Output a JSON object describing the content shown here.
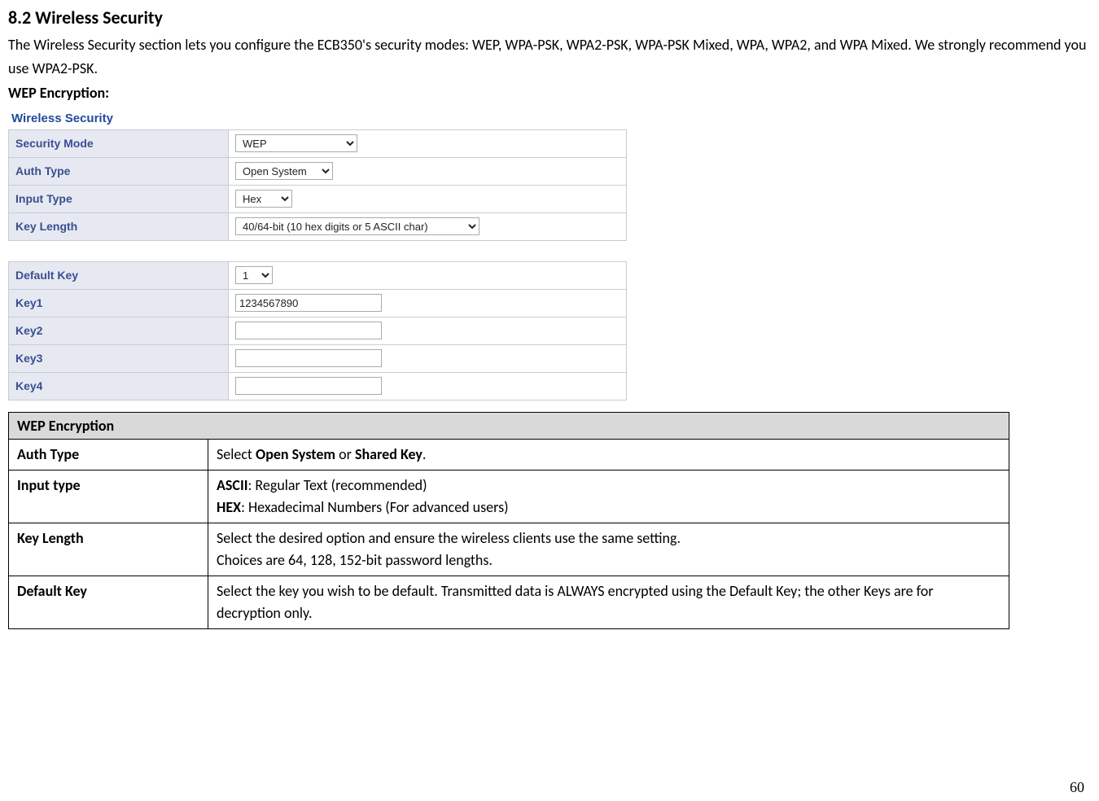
{
  "heading": "8.2   Wireless Security",
  "intro": "The Wireless Security section lets you configure the ECB350's security modes: WEP, WPA-PSK, WPA2-PSK, WPA-PSK Mixed, WPA, WPA2, and WPA Mixed. We strongly recommend you use WPA2-PSK.",
  "subheading": "WEP Encryption:",
  "panel": {
    "title": "Wireless Security",
    "rows1": {
      "security_mode": {
        "label": "Security Mode",
        "value": "WEP"
      },
      "auth_type": {
        "label": "Auth Type",
        "value": "Open System"
      },
      "input_type": {
        "label": "Input Type",
        "value": "Hex"
      },
      "key_length": {
        "label": "Key Length",
        "value": "40/64-bit (10 hex digits or 5 ASCII char)"
      }
    },
    "rows2": {
      "default_key": {
        "label": "Default Key",
        "value": "1"
      },
      "key1": {
        "label": "Key1",
        "value": "1234567890"
      },
      "key2": {
        "label": "Key2",
        "value": ""
      },
      "key3": {
        "label": "Key3",
        "value": ""
      },
      "key4": {
        "label": "Key4",
        "value": ""
      }
    }
  },
  "desc": {
    "header": "WEP Encryption",
    "rows": {
      "auth_type": {
        "label": "Auth Type",
        "textA": "Select ",
        "bold1": "Open System",
        "textB": " or ",
        "bold2": "Shared Key",
        "textC": "."
      },
      "input_type": {
        "label": "Input type",
        "bold1": "ASCII",
        "line1": ": Regular Text (recommended)",
        "bold2": "HEX",
        "line2": ": Hexadecimal Numbers (For advanced users)"
      },
      "key_length": {
        "label": "Key Length",
        "line1": "Select the desired option and ensure the wireless clients use the same setting.",
        "line2": "Choices are 64, 128, 152-bit password lengths."
      },
      "default_key": {
        "label": "Default Key",
        "text": "Select the key you wish to be default. Transmitted data is ALWAYS encrypted using the Default Key; the other Keys are for decryption only."
      }
    }
  },
  "page_num": "60"
}
